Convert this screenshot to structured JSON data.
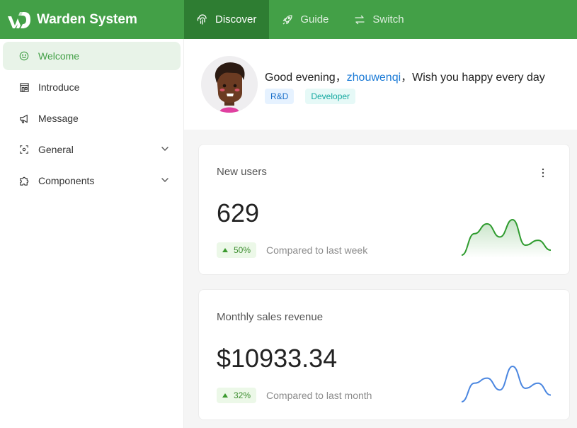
{
  "brand": {
    "title": "Warden System"
  },
  "topnav": [
    {
      "label": "Discover",
      "icon": "fingerprint-icon",
      "active": true
    },
    {
      "label": "Guide",
      "icon": "rocket-icon",
      "active": false
    },
    {
      "label": "Switch",
      "icon": "swap-icon",
      "active": false
    }
  ],
  "sidebar": {
    "items": [
      {
        "label": "Welcome",
        "icon": "smile-icon",
        "active": true
      },
      {
        "label": "Introduce",
        "icon": "shop-icon",
        "active": false
      },
      {
        "label": "Message",
        "icon": "megaphone-icon",
        "active": false
      },
      {
        "label": "General",
        "icon": "scan-icon",
        "active": false,
        "expandable": true
      },
      {
        "label": "Components",
        "icon": "puzzle-icon",
        "active": false,
        "expandable": true
      }
    ]
  },
  "welcome": {
    "greeting_prefix": "Good evening，",
    "username": "zhouwenqi",
    "greeting_suffix": "，Wish you happy every day",
    "tags": [
      "R&D",
      "Developer"
    ]
  },
  "cards": [
    {
      "title": "New users",
      "value": "629",
      "change": "50%",
      "trend": "up",
      "compare_text": "Compared to last week",
      "spark_color": "#2e9b2e",
      "spark": [
        2,
        28,
        40,
        24,
        45,
        14,
        20,
        8
      ]
    },
    {
      "title": "Monthly sales revenue",
      "value": "$10933.34",
      "change": "32%",
      "trend": "up",
      "compare_text": "Compared to last month",
      "spark_color": "#4a86e0",
      "spark": [
        2,
        24,
        30,
        16,
        44,
        18,
        24,
        10
      ]
    }
  ],
  "colors": {
    "header": "#43a047",
    "header_active": "#2e7d32",
    "accent": "#43a047"
  }
}
